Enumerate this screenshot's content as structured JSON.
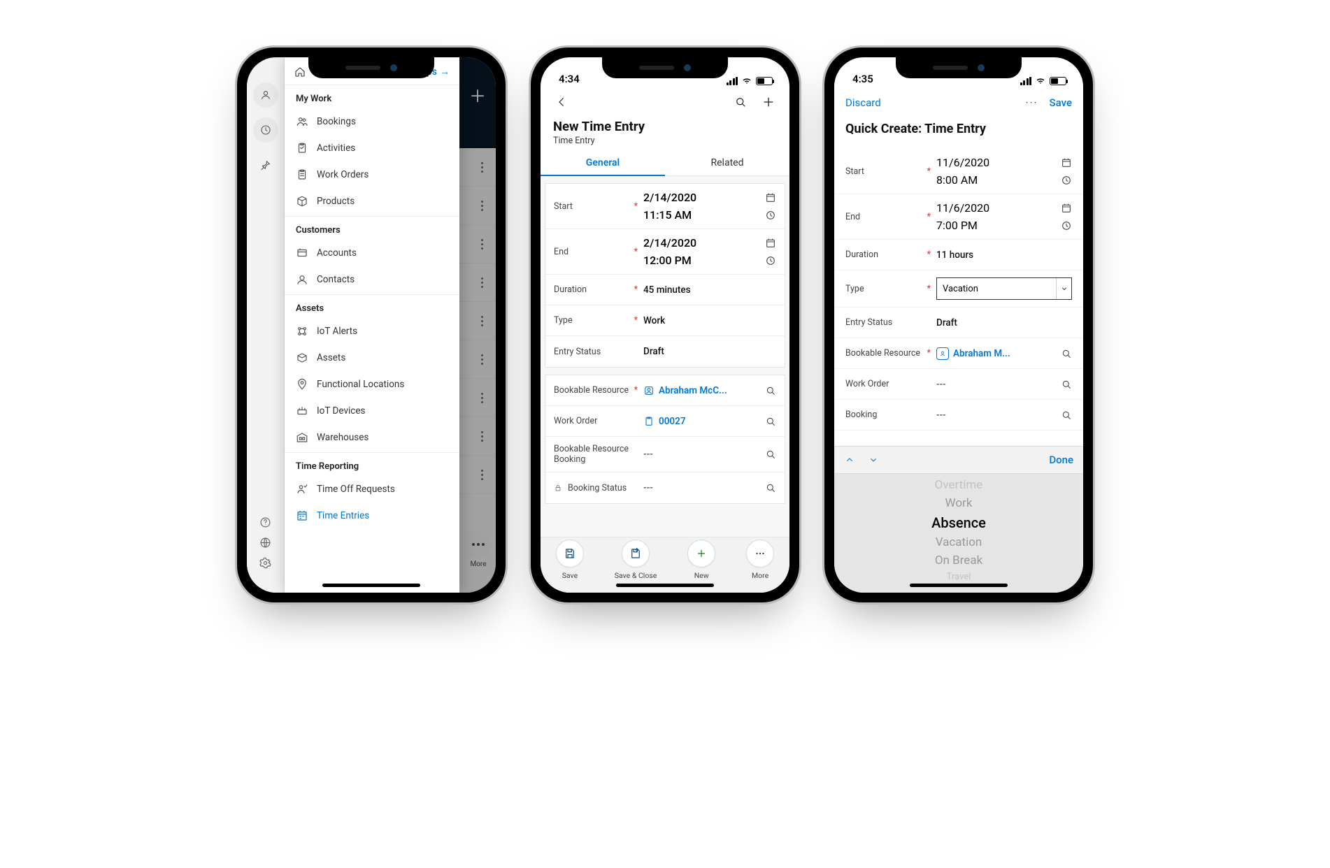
{
  "phone1": {
    "drawer": {
      "home": "Home",
      "apps": "Apps",
      "sections": {
        "mywork": {
          "label": "My Work",
          "items": [
            "Bookings",
            "Activities",
            "Work Orders",
            "Products"
          ]
        },
        "customers": {
          "label": "Customers",
          "items": [
            "Accounts",
            "Contacts"
          ]
        },
        "assets": {
          "label": "Assets",
          "items": [
            "IoT Alerts",
            "Assets",
            "Functional Locations",
            "IoT Devices",
            "Warehouses"
          ]
        },
        "timereporting": {
          "label": "Time Reporting",
          "items": [
            "Time Off Requests",
            "Time Entries"
          ]
        }
      }
    },
    "bg_more": "More"
  },
  "phone2": {
    "status_time": "4:34",
    "title": "New Time Entry",
    "subtitle": "Time Entry",
    "tabs": {
      "general": "General",
      "related": "Related"
    },
    "fields": {
      "start": {
        "label": "Start",
        "date": "2/14/2020",
        "time": "11:15 AM"
      },
      "end": {
        "label": "End",
        "date": "2/14/2020",
        "time": "12:00 PM"
      },
      "duration": {
        "label": "Duration",
        "value": "45 minutes"
      },
      "type": {
        "label": "Type",
        "value": "Work"
      },
      "entry_status": {
        "label": "Entry Status",
        "value": "Draft"
      },
      "bookable_resource": {
        "label": "Bookable Resource",
        "value": "Abraham McC..."
      },
      "work_order": {
        "label": "Work Order",
        "value": "00027"
      },
      "brb": {
        "label": "Bookable Resource Booking",
        "value": "---"
      },
      "booking_status": {
        "label": "Booking Status",
        "value": "---"
      }
    },
    "buttons": {
      "save": "Save",
      "save_close": "Save & Close",
      "new": "New",
      "more": "More"
    }
  },
  "phone3": {
    "status_time": "4:35",
    "header": {
      "discard": "Discard",
      "save": "Save"
    },
    "title": "Quick Create: Time Entry",
    "fields": {
      "start": {
        "label": "Start",
        "date": "11/6/2020",
        "time": "8:00 AM"
      },
      "end": {
        "label": "End",
        "date": "11/6/2020",
        "time": "7:00 PM"
      },
      "duration": {
        "label": "Duration",
        "value": "11 hours"
      },
      "type": {
        "label": "Type",
        "value": "Vacation"
      },
      "entry_status": {
        "label": "Entry Status",
        "value": "Draft"
      },
      "bookable_resource": {
        "label": "Bookable Resource",
        "value": "Abraham M..."
      },
      "work_order": {
        "label": "Work Order",
        "value": "---"
      },
      "booking": {
        "label": "Booking",
        "value": "---"
      }
    },
    "picker": {
      "done": "Done",
      "options": [
        "Overtime",
        "Work",
        "Absence",
        "Vacation",
        "On Break",
        "Travel"
      ]
    }
  }
}
